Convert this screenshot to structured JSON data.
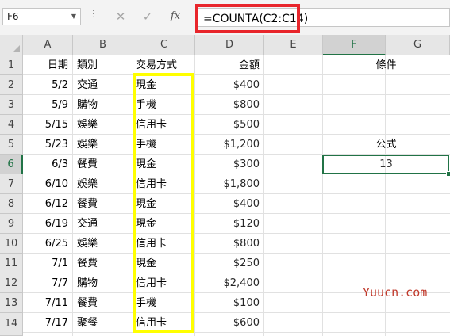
{
  "formula_bar": {
    "name_box": "F6",
    "cancel_icon": "✕",
    "enter_icon": "✓",
    "fx_label": "fx",
    "formula": "=COUNTA(C2:C14)"
  },
  "columns": [
    "A",
    "B",
    "C",
    "D",
    "E",
    "F",
    "G"
  ],
  "rows": [
    "1",
    "2",
    "3",
    "4",
    "5",
    "6",
    "7",
    "8",
    "9",
    "10",
    "11",
    "12",
    "13",
    "14"
  ],
  "headers": {
    "date": "日期",
    "category": "類別",
    "payment": "交易方式",
    "amount": "金額",
    "criteria": "條件",
    "formula_label": "公式"
  },
  "records": [
    {
      "date": "5/2",
      "category": "交通",
      "payment": "現金",
      "amount": "$400"
    },
    {
      "date": "5/9",
      "category": "購物",
      "payment": "手機",
      "amount": "$800"
    },
    {
      "date": "5/15",
      "category": "娛樂",
      "payment": "信用卡",
      "amount": "$500"
    },
    {
      "date": "5/23",
      "category": "娛樂",
      "payment": "手機",
      "amount": "$1,200"
    },
    {
      "date": "6/3",
      "category": "餐費",
      "payment": "現金",
      "amount": "$300"
    },
    {
      "date": "6/10",
      "category": "娛樂",
      "payment": "信用卡",
      "amount": "$1,800"
    },
    {
      "date": "6/12",
      "category": "餐費",
      "payment": "現金",
      "amount": "$400"
    },
    {
      "date": "6/19",
      "category": "交通",
      "payment": "現金",
      "amount": "$120"
    },
    {
      "date": "6/25",
      "category": "娛樂",
      "payment": "信用卡",
      "amount": "$800"
    },
    {
      "date": "7/1",
      "category": "餐費",
      "payment": "現金",
      "amount": "$250"
    },
    {
      "date": "7/7",
      "category": "購物",
      "payment": "信用卡",
      "amount": "$2,400"
    },
    {
      "date": "7/11",
      "category": "餐費",
      "payment": "手機",
      "amount": "$100"
    },
    {
      "date": "7/17",
      "category": "聚餐",
      "payment": "信用卡",
      "amount": "$600"
    }
  ],
  "result": "13",
  "watermark": "Yuucn.com",
  "colors": {
    "selection_green": "#217346",
    "highlight_red": "#e8252b",
    "highlight_yellow": "#ffff00"
  }
}
